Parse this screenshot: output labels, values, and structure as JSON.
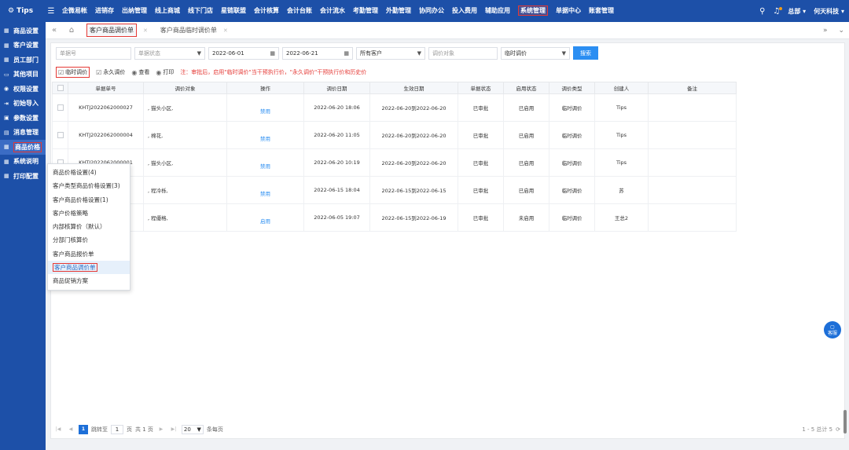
{
  "topbar": {
    "brand": "Tips",
    "nav": [
      "企微易帐",
      "进销存",
      "出纳管理",
      "线上商城",
      "线下门店",
      "星链联盟",
      "会计核算",
      "会计台账",
      "会计流水",
      "考勤管理",
      "外勤管理",
      "协同办公",
      "投入费用",
      "辅助应用",
      "系统管理",
      "单据中心",
      "账套管理"
    ],
    "active_nav_index": 14,
    "user": "总部",
    "company": "何天科技"
  },
  "sidebar": {
    "items": [
      "商品设置",
      "客户设置",
      "员工部门",
      "其他项目",
      "权限设置",
      "初始导入",
      "参数设置",
      "消息管理",
      "商品价格",
      "系统说明",
      "打印配置"
    ],
    "active_index": 8
  },
  "tabs": [
    {
      "label": "客户商品调价单"
    },
    {
      "label": "客户商品临时调价单"
    }
  ],
  "filters": {
    "doc_no_placeholder": "单据号",
    "doc_status_placeholder": "单据状态",
    "date_from": "2022-06-01",
    "date_to": "2022-06-21",
    "customer": "所有客户",
    "adjust_object_placeholder": "调价对象",
    "adjust_type": "临时调价",
    "search_label": "搜索"
  },
  "toolbar": {
    "temp_adjust": "临时调价",
    "perm_adjust": "永久调价",
    "view": "查看",
    "print": "打印",
    "note": "注：审批后，启用\"临时调价\"当干预执行价，\"永久调价\"干预执行价和历史价"
  },
  "table": {
    "columns": [
      "单据单号",
      "调价对象",
      "操作",
      "调价日期",
      "生效日期",
      "单据状态",
      "启用状态",
      "调价类型",
      "创建人",
      "备注"
    ],
    "rows": [
      {
        "no": "KHTJ2022062000027",
        "object": ", 猫头小区,",
        "op": "禁用",
        "date": "2022-06-20 18:06",
        "effective": "2022-06-20到2022-06-20",
        "status": "已审批",
        "enabled": "已启用",
        "type": "临时调价",
        "creator": "Tips",
        "remark": ""
      },
      {
        "no": "KHTJ2022062000004",
        "object": ", 棉花,",
        "op": "禁用",
        "date": "2022-06-20 11:05",
        "effective": "2022-06-20到2022-06-20",
        "status": "已审批",
        "enabled": "已启用",
        "type": "临时调价",
        "creator": "Tips",
        "remark": ""
      },
      {
        "no": "KHTJ2022062000001",
        "object": ", 猫头小区,",
        "op": "禁用",
        "date": "2022-06-20 10:19",
        "effective": "2022-06-20到2022-06-20",
        "status": "已审批",
        "enabled": "已启用",
        "type": "临时调价",
        "creator": "Tips",
        "remark": ""
      },
      {
        "no": "",
        "object": ", 程冷栎,",
        "op": "禁用",
        "date": "2022-06-15 18:04",
        "effective": "2022-06-15到2022-06-15",
        "status": "已审批",
        "enabled": "已启用",
        "type": "临时调价",
        "creator": "苏",
        "remark": ""
      },
      {
        "no": "",
        "object": ", 程優格,",
        "op": "启用",
        "date": "2022-06-05 19:07",
        "effective": "2022-06-15到2022-06-19",
        "status": "已审批",
        "enabled": "未启用",
        "type": "临时调价",
        "creator": "王总2",
        "remark": ""
      }
    ]
  },
  "popup_menu": {
    "items": [
      "商品价格设置(4)",
      "客户类型商品价格设置(3)",
      "客户商品价格设置(1)",
      "客户价格策略",
      "内部核算价（默认）",
      "分部门核算价",
      "客户商品报价单",
      "客户商品调价单",
      "商品促销方案"
    ],
    "active_index": 7
  },
  "pager": {
    "current": "1",
    "goto_label": "跳转至",
    "page_input": "1",
    "page_unit": "页",
    "total_pages": "共 1 页",
    "page_size": "20",
    "per_page_label": "条每页",
    "summary": "1 - 5 总计 5"
  },
  "float": {
    "service": "客服"
  },
  "colors": {
    "brand": "#1d50a8",
    "accent": "#2b8ef2",
    "highlight": "#e53935"
  }
}
